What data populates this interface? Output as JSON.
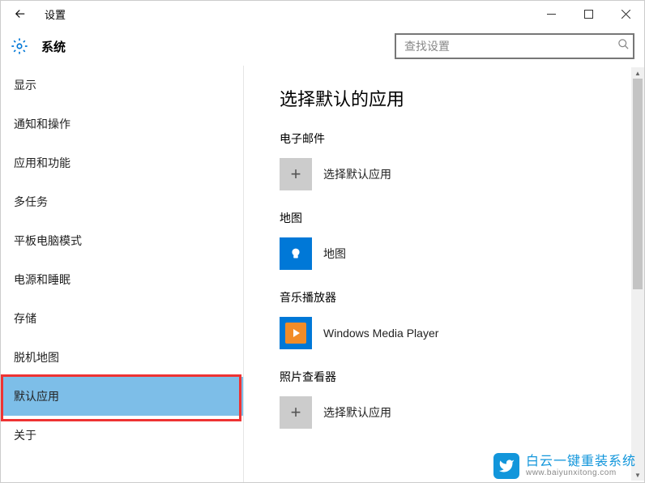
{
  "window": {
    "title": "设置"
  },
  "header": {
    "section": "系统",
    "search_placeholder": "查找设置"
  },
  "sidebar": {
    "items": [
      {
        "label": "显示"
      },
      {
        "label": "通知和操作"
      },
      {
        "label": "应用和功能"
      },
      {
        "label": "多任务"
      },
      {
        "label": "平板电脑模式"
      },
      {
        "label": "电源和睡眠"
      },
      {
        "label": "存储"
      },
      {
        "label": "脱机地图"
      },
      {
        "label": "默认应用",
        "selected": true
      },
      {
        "label": "关于"
      }
    ]
  },
  "main": {
    "heading": "选择默认的应用",
    "categories": [
      {
        "key": "email",
        "label": "电子邮件",
        "app_label": "选择默认应用",
        "tile": "plus"
      },
      {
        "key": "maps",
        "label": "地图",
        "app_label": "地图",
        "tile": "maps"
      },
      {
        "key": "music",
        "label": "音乐播放器",
        "app_label": "Windows Media Player",
        "tile": "wmp"
      },
      {
        "key": "photo",
        "label": "照片查看器",
        "app_label": "选择默认应用",
        "tile": "plus"
      }
    ]
  },
  "watermark": {
    "line1": "白云一键重装系统",
    "line2": "www.baiyunxitong.com"
  }
}
